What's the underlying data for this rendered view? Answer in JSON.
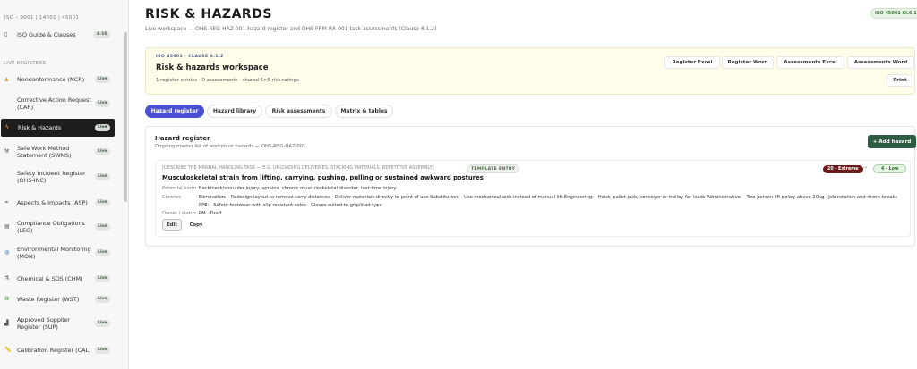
{
  "sidebar": {
    "top_text": "ISO – 9001 | 14001 | 45001",
    "guide": {
      "icon": "book-icon",
      "label": "ISO Guide & Clauses",
      "badge": "4–10"
    },
    "section_label": "LIVE REGISTERS",
    "items": [
      {
        "icon": "warning-icon",
        "label": "Nonconformance (NCR)",
        "badge": "Live"
      },
      {
        "icon": "blank-icon",
        "label": "Corrective Action Request (CAR)",
        "badge": "Live"
      },
      {
        "icon": "bolt-icon",
        "label": "Risk & Hazards",
        "badge": "Live",
        "active": true
      },
      {
        "icon": "tools-icon",
        "label": "Safe Work Method Statement (SWMS)",
        "badge": "Live"
      },
      {
        "icon": "blank-icon",
        "label": "Safety Incident Register (OHS-INC)",
        "badge": "Live"
      },
      {
        "icon": "leaf-icon",
        "label": "Aspects & Impacts (ASP)",
        "badge": "Live"
      },
      {
        "icon": "clipboard-icon",
        "label": "Compliance Obligations (LEG)",
        "badge": "Live"
      },
      {
        "icon": "globe-icon",
        "label": "Environmental Monitoring (MON)",
        "badge": "Live"
      },
      {
        "icon": "flask-icon",
        "label": "Chemical & SDS (CHM)",
        "badge": "Live"
      },
      {
        "icon": "recycle-icon",
        "label": "Waste Register (WST)",
        "badge": "Live"
      },
      {
        "icon": "factory-icon",
        "label": "Approved Supplier Register (SUP)",
        "badge": "Live"
      },
      {
        "icon": "ruler-icon",
        "label": "Calibration Register (CAL)",
        "badge": "Live"
      }
    ]
  },
  "header": {
    "title": "RISK & HAZARDS",
    "subtitle": "Live workspace — OHS-REG-HAZ-001 hazard register and OHS-FRM-RA-001 task assessments (Clause 6.1.2)",
    "iso_badge": "ISO 45001 Cl.6.1.2"
  },
  "workspace": {
    "kicker": "ISO 45001 · CLAUSE 6.1.2",
    "title": "Risk & hazards workspace",
    "meta": "1 register entries · 0 assessments · shared 5×5 risk ratings",
    "buttons": [
      "Register Excel",
      "Register Word",
      "Assessments Excel",
      "Assessments Word"
    ],
    "print_label": "Print"
  },
  "tabs": [
    "Hazard register",
    "Hazard library",
    "Risk assessments",
    "Matrix & tables"
  ],
  "register": {
    "title": "Hazard register",
    "subtitle": "Ongoing master list of workplace hazards — OHS-REG-HAZ-001.",
    "add_label": "+ Add hazard",
    "entry": {
      "tag": "[DESCRIBE THE MANUAL HANDLING TASK — E.G. UNLOADING DELIVERIES, STACKING MATERIALS, REPETITIVE ASSEMBLY]",
      "template_badge": "TEMPLATE ENTRY",
      "title": "Musculoskeletal strain from lifting, carrying, pushing, pulling or sustained awkward postures",
      "initial_risk": "20 - Extreme",
      "arrow": "→",
      "residual_risk": "4 - Low",
      "harm_label": "Potential harm",
      "harm_value": "Back/neck/shoulder injury, sprains, chronic musculoskeletal disorder, lost-time injury",
      "controls_label": "Controls",
      "controls_value": "Elimination: · Redesign layout to remove carry distances · Deliver materials directly to point of use Substitution: · Use mechanical aids instead of manual lift Engineering: · Hoist, pallet jack, conveyor or trolley for loads Administrative: · Two-person lift policy above 20kg · Job rotation and micro-breaks PPE: · Safety footwear with slip-resistant soles · Gloves suited to grip/load type",
      "owner_label": "Owner / status",
      "owner_value": "PM · Draft",
      "edit_label": "Edit",
      "copy_label": "Copy"
    }
  },
  "colors": {
    "accent": "#4b4fd3",
    "primary_action": "#2f5d43",
    "extreme": "#6b1a1a",
    "low": "#2e6b2e",
    "workspace_bg": "#fffdea"
  }
}
